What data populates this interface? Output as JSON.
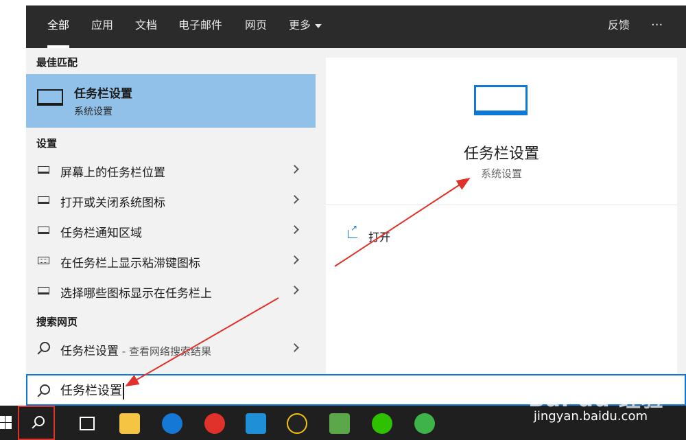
{
  "tabs": [
    {
      "label": "全部",
      "active": true
    },
    {
      "label": "应用"
    },
    {
      "label": "文档"
    },
    {
      "label": "电子邮件"
    },
    {
      "label": "网页"
    },
    {
      "label": "更多"
    }
  ],
  "topbar_right": {
    "feedback": "反馈",
    "more": "···"
  },
  "best_match": {
    "section_title": "最佳匹配",
    "title": "任务栏设置",
    "subtitle": "系统设置",
    "icon": "taskbar-monitor-icon"
  },
  "settings": {
    "section_title": "设置",
    "items": [
      {
        "label": "屏幕上的任务栏位置",
        "icon": "taskbar-icon"
      },
      {
        "label": "打开或关闭系统图标",
        "icon": "taskbar-icon"
      },
      {
        "label": "任务栏通知区域",
        "icon": "taskbar-icon"
      },
      {
        "label": "在任务栏上显示粘滞键图标",
        "icon": "keyboard-icon"
      },
      {
        "label": "选择哪些图标显示在任务栏上",
        "icon": "taskbar-icon"
      }
    ]
  },
  "web": {
    "section_title": "搜索网页",
    "item_label": "任务栏设置",
    "item_suffix": " - 查看网络搜索结果"
  },
  "preview": {
    "title": "任务栏设置",
    "subtitle": "系统设置",
    "action_open": "打开"
  },
  "search": {
    "value": "任务栏设置"
  },
  "taskbar_apps": [
    "task-view-icon",
    "file-explorer-icon",
    "teamviewer-icon",
    "netease-music-icon",
    "app-icon",
    "qq-icon",
    "evernote-icon",
    "wechat-icon",
    "browser-icon"
  ],
  "watermark": {
    "logo": "Bai du 经验",
    "url": "jingyan.baidu.com"
  },
  "colors": {
    "accent": "#0f78d4",
    "highlight": "#91c1e8",
    "topbar": "#2b2b2b",
    "annotation": "#e0322b"
  }
}
